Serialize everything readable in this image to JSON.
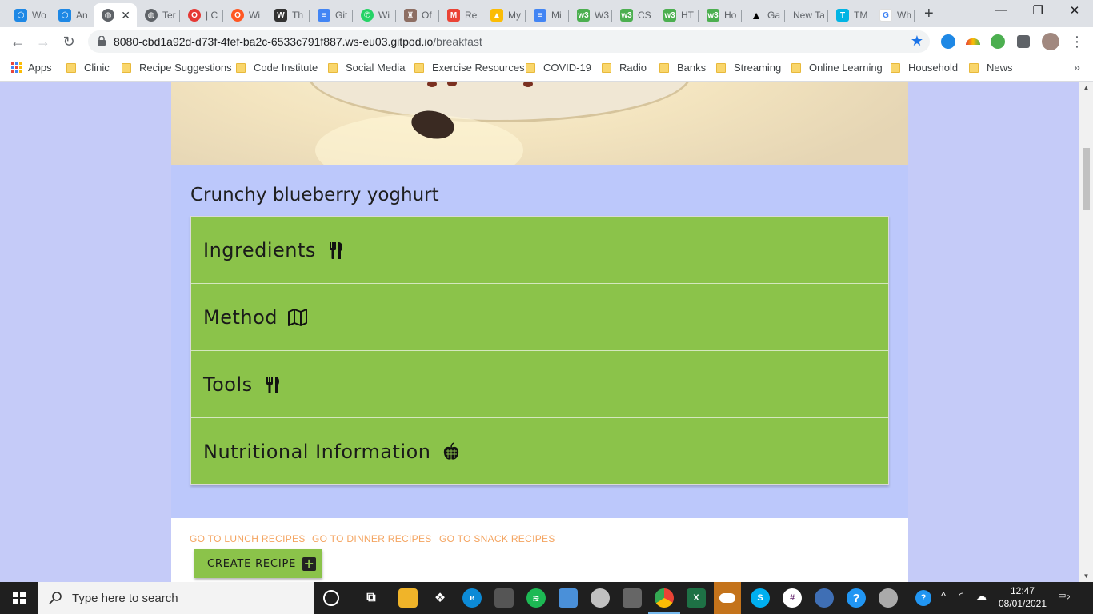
{
  "browser": {
    "tabs": [
      {
        "title": "Wo",
        "icon": "hexagon-icon",
        "color": "#1e88e5"
      },
      {
        "title": "An",
        "icon": "hexagon-icon",
        "color": "#1e88e5"
      },
      {
        "title": "",
        "icon": "globe-icon",
        "color": "#5f6368",
        "active": true
      },
      {
        "title": "Ter",
        "icon": "globe-icon",
        "color": "#5f6368"
      },
      {
        "title": "| C",
        "icon": "opera-icon",
        "color": "#e53935"
      },
      {
        "title": "Wi",
        "icon": "opera-icon",
        "color": "#ff5722"
      },
      {
        "title": "Th",
        "icon": "w3-icon",
        "color": "#333333"
      },
      {
        "title": "Git",
        "icon": "docs-icon",
        "color": "#4285f4"
      },
      {
        "title": "Wi",
        "icon": "whatsapp-icon",
        "color": "#25d366"
      },
      {
        "title": "Of",
        "icon": "shield-icon",
        "color": "#8d6e63"
      },
      {
        "title": "Re",
        "icon": "gmail-icon",
        "color": "#ea4335"
      },
      {
        "title": "My",
        "icon": "drive-icon",
        "color": "#fbbc05"
      },
      {
        "title": "Mi",
        "icon": "docs-icon",
        "color": "#4285f4"
      },
      {
        "title": "W3",
        "icon": "w3-icon",
        "color": "#4caf50"
      },
      {
        "title": "CS",
        "icon": "w3-icon",
        "color": "#4caf50"
      },
      {
        "title": "HT",
        "icon": "w3-icon",
        "color": "#4caf50"
      },
      {
        "title": "Ho",
        "icon": "w3-icon",
        "color": "#4caf50"
      },
      {
        "title": "Ga",
        "icon": "triangle-icon",
        "color": "#000000"
      },
      {
        "title": "New Ta",
        "icon": "",
        "color": ""
      },
      {
        "title": "TM",
        "icon": "tmdb-icon",
        "color": "#01b4e4"
      },
      {
        "title": "Wh",
        "icon": "google-icon",
        "color": "#4285f4"
      }
    ],
    "url_host": "8080-cbd1a92d-d73f-4fef-ba2c-6533c791f887.ws-eu03.gitpod.io",
    "url_path": "/breakfast",
    "bookmarks": [
      "Apps",
      "Clinic",
      "Recipe Suggestions",
      "Code Institute",
      "Social Media",
      "Exercise Resources",
      "COVID-19",
      "Radio",
      "Banks",
      "Streaming",
      "Online Learning",
      "Household",
      "News"
    ]
  },
  "page": {
    "recipe_title": "Crunchy blueberry yoghurt",
    "accordion": [
      {
        "label": "Ingredients",
        "icon": "utensils-icon"
      },
      {
        "label": "Method",
        "icon": "map-icon"
      },
      {
        "label": "Tools",
        "icon": "utensils-icon"
      },
      {
        "label": "Nutritional Information",
        "icon": "apple-icon"
      }
    ],
    "footer_links": [
      "GO TO LUNCH RECIPES",
      "GO TO DINNER RECIPES",
      "GO TO SNACK RECIPES"
    ],
    "create_button": "CREATE RECIPE"
  },
  "taskbar": {
    "search_placeholder": "Type here to search",
    "time": "12:47",
    "date": "08/01/2021",
    "notifications": "2"
  },
  "colors": {
    "page_bg": "#c5cbf8",
    "accordion_green": "#8bc34a",
    "link_orange": "#f4a460"
  }
}
